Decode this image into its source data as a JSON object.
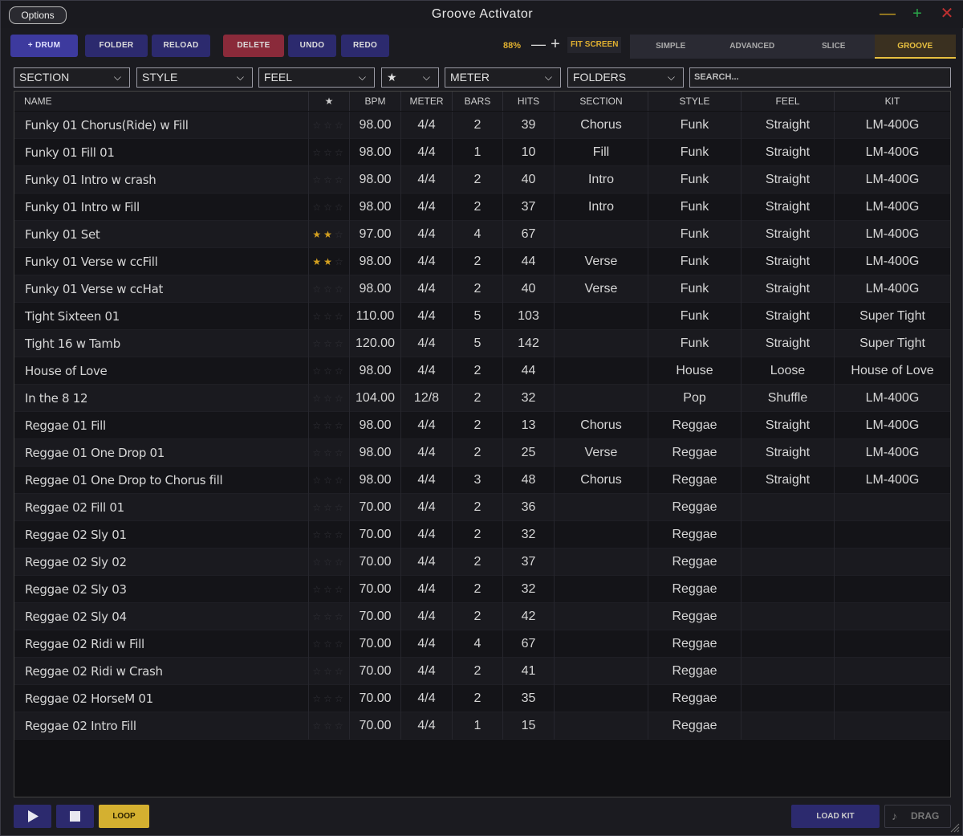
{
  "window": {
    "title": "Groove Activator",
    "options_label": "Options",
    "minimize": "—",
    "maximize": "+",
    "close": "✕"
  },
  "toolbar": {
    "drum_label": "+ DRUM",
    "folder_label": "FOLDER",
    "reload_label": "RELOAD",
    "delete_label": "DELETE",
    "undo_label": "UNDO",
    "redo_label": "REDO",
    "zoom": "88%",
    "zoom_minus": "—",
    "zoom_plus": "+",
    "fit_screen_label": "FIT SCREEN",
    "modes": [
      "SIMPLE",
      "ADVANCED",
      "SLICE",
      "GROOVE"
    ],
    "active_mode": "GROOVE"
  },
  "filters": {
    "section": "SECTION",
    "style": "STYLE",
    "feel": "FEEL",
    "star": "★",
    "meter": "METER",
    "folders": "FOLDERS",
    "search_placeholder": "SEARCH..."
  },
  "table": {
    "columns": [
      "NAME",
      "★",
      "BPM",
      "METER",
      "BARS",
      "HITS",
      "SECTION",
      "STYLE",
      "FEEL",
      "KIT"
    ],
    "rows": [
      {
        "name": "Funky 01 Chorus(Ride) w Fill",
        "stars": 0,
        "bpm": "98.00",
        "meter": "4/4",
        "bars": "2",
        "hits": "39",
        "section": "Chorus",
        "style": "Funk",
        "feel": "Straight",
        "kit": "LM-400G"
      },
      {
        "name": "Funky 01 Fill 01",
        "stars": 0,
        "bpm": "98.00",
        "meter": "4/4",
        "bars": "1",
        "hits": "10",
        "section": "Fill",
        "style": "Funk",
        "feel": "Straight",
        "kit": "LM-400G"
      },
      {
        "name": "Funky 01 Intro w crash",
        "stars": 0,
        "bpm": "98.00",
        "meter": "4/4",
        "bars": "2",
        "hits": "40",
        "section": "Intro",
        "style": "Funk",
        "feel": "Straight",
        "kit": "LM-400G"
      },
      {
        "name": "Funky 01 Intro w Fill",
        "stars": 0,
        "bpm": "98.00",
        "meter": "4/4",
        "bars": "2",
        "hits": "37",
        "section": "Intro",
        "style": "Funk",
        "feel": "Straight",
        "kit": "LM-400G"
      },
      {
        "name": "Funky 01 Set",
        "stars": 2,
        "bpm": "97.00",
        "meter": "4/4",
        "bars": "4",
        "hits": "67",
        "section": "",
        "style": "Funk",
        "feel": "Straight",
        "kit": "LM-400G"
      },
      {
        "name": "Funky 01 Verse w ccFill",
        "stars": 2,
        "bpm": "98.00",
        "meter": "4/4",
        "bars": "2",
        "hits": "44",
        "section": "Verse",
        "style": "Funk",
        "feel": "Straight",
        "kit": "LM-400G"
      },
      {
        "name": "Funky 01 Verse w ccHat",
        "stars": 0,
        "bpm": "98.00",
        "meter": "4/4",
        "bars": "2",
        "hits": "40",
        "section": "Verse",
        "style": "Funk",
        "feel": "Straight",
        "kit": "LM-400G"
      },
      {
        "name": "Tight Sixteen 01",
        "stars": 0,
        "bpm": "110.00",
        "meter": "4/4",
        "bars": "5",
        "hits": "103",
        "section": "",
        "style": "Funk",
        "feel": "Straight",
        "kit": "Super Tight"
      },
      {
        "name": "Tight 16 w Tamb",
        "stars": 0,
        "bpm": "120.00",
        "meter": "4/4",
        "bars": "5",
        "hits": "142",
        "section": "",
        "style": "Funk",
        "feel": "Straight",
        "kit": "Super Tight"
      },
      {
        "name": "House of Love",
        "stars": 0,
        "bpm": "98.00",
        "meter": "4/4",
        "bars": "2",
        "hits": "44",
        "section": "",
        "style": "House",
        "feel": "Loose",
        "kit": "House of Love"
      },
      {
        "name": "In the 8 12",
        "stars": 0,
        "bpm": "104.00",
        "meter": "12/8",
        "bars": "2",
        "hits": "32",
        "section": "",
        "style": "Pop",
        "feel": "Shuffle",
        "kit": "LM-400G"
      },
      {
        "name": "Reggae 01 Fill",
        "stars": 0,
        "bpm": "98.00",
        "meter": "4/4",
        "bars": "2",
        "hits": "13",
        "section": "Chorus",
        "style": "Reggae",
        "feel": "Straight",
        "kit": "LM-400G"
      },
      {
        "name": "Reggae 01 One Drop 01",
        "stars": 0,
        "bpm": "98.00",
        "meter": "4/4",
        "bars": "2",
        "hits": "25",
        "section": "Verse",
        "style": "Reggae",
        "feel": "Straight",
        "kit": "LM-400G"
      },
      {
        "name": "Reggae 01 One Drop to Chorus fill",
        "stars": 0,
        "bpm": "98.00",
        "meter": "4/4",
        "bars": "3",
        "hits": "48",
        "section": "Chorus",
        "style": "Reggae",
        "feel": "Straight",
        "kit": "LM-400G"
      },
      {
        "name": "Reggae 02 Fill 01",
        "stars": 0,
        "bpm": "70.00",
        "meter": "4/4",
        "bars": "2",
        "hits": "36",
        "section": "",
        "style": "Reggae",
        "feel": "",
        "kit": ""
      },
      {
        "name": "Reggae 02 Sly 01",
        "stars": 0,
        "bpm": "70.00",
        "meter": "4/4",
        "bars": "2",
        "hits": "32",
        "section": "",
        "style": "Reggae",
        "feel": "",
        "kit": ""
      },
      {
        "name": "Reggae 02 Sly 02",
        "stars": 0,
        "bpm": "70.00",
        "meter": "4/4",
        "bars": "2",
        "hits": "37",
        "section": "",
        "style": "Reggae",
        "feel": "",
        "kit": ""
      },
      {
        "name": "Reggae 02 Sly 03",
        "stars": 0,
        "bpm": "70.00",
        "meter": "4/4",
        "bars": "2",
        "hits": "32",
        "section": "",
        "style": "Reggae",
        "feel": "",
        "kit": ""
      },
      {
        "name": "Reggae 02 Sly 04",
        "stars": 0,
        "bpm": "70.00",
        "meter": "4/4",
        "bars": "2",
        "hits": "42",
        "section": "",
        "style": "Reggae",
        "feel": "",
        "kit": ""
      },
      {
        "name": "Reggae 02 Ridi w Fill",
        "stars": 0,
        "bpm": "70.00",
        "meter": "4/4",
        "bars": "4",
        "hits": "67",
        "section": "",
        "style": "Reggae",
        "feel": "",
        "kit": ""
      },
      {
        "name": "Reggae 02 Ridi w Crash",
        "stars": 0,
        "bpm": "70.00",
        "meter": "4/4",
        "bars": "2",
        "hits": "41",
        "section": "",
        "style": "Reggae",
        "feel": "",
        "kit": ""
      },
      {
        "name": "Reggae 02 HorseM 01",
        "stars": 0,
        "bpm": "70.00",
        "meter": "4/4",
        "bars": "2",
        "hits": "35",
        "section": "",
        "style": "Reggae",
        "feel": "",
        "kit": ""
      },
      {
        "name": "Reggae 02 Intro Fill",
        "stars": 0,
        "bpm": "70.00",
        "meter": "4/4",
        "bars": "1",
        "hits": "15",
        "section": "",
        "style": "Reggae",
        "feel": "",
        "kit": ""
      }
    ]
  },
  "transport": {
    "play_icon": "play-icon",
    "stop_icon": "stop-icon",
    "loop_label": "LOOP",
    "load_kit_label": "LOAD KIT",
    "drag_label": "DRAG",
    "drag_icon": "music-note-icon"
  },
  "colors": {
    "accent_gold": "#d4b030",
    "button_purple": "#2c2a6e",
    "delete_red": "#8a2a3a",
    "star_on": "#d4a020"
  }
}
